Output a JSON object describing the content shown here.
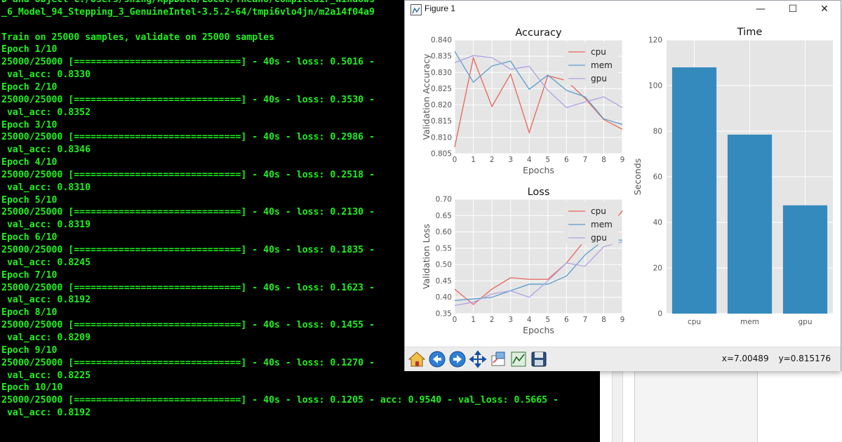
{
  "terminal": {
    "lines": [
      "D and object C:/Users/shing/AppData/Local/Theano/compiledir_Windows",
      "_6_Model_94_Stepping_3_GenuineIntel-3.5.2-64/tmpi6vlo4jn/m2a14f04a9",
      "",
      "Train on 25000 samples, validate on 25000 samples",
      "Epoch 1/10",
      "25000/25000 [==============================] - 40s - loss: 0.5016 -",
      " val_acc: 0.8330",
      "Epoch 2/10",
      "25000/25000 [==============================] - 40s - loss: 0.3530 -",
      " val_acc: 0.8352",
      "Epoch 3/10",
      "25000/25000 [==============================] - 40s - loss: 0.2986 -",
      " val_acc: 0.8346",
      "Epoch 4/10",
      "25000/25000 [==============================] - 40s - loss: 0.2518 -",
      " val_acc: 0.8310",
      "Epoch 5/10",
      "25000/25000 [==============================] - 40s - loss: 0.2130 -",
      " val_acc: 0.8319",
      "Epoch 6/10",
      "25000/25000 [==============================] - 40s - loss: 0.1835 -",
      " val_acc: 0.8245",
      "Epoch 7/10",
      "25000/25000 [==============================] - 40s - loss: 0.1623 -",
      " val_acc: 0.8192",
      "Epoch 8/10",
      "25000/25000 [==============================] - 40s - loss: 0.1455 -",
      " val_acc: 0.8209",
      "Epoch 9/10",
      "25000/25000 [==============================] - 40s - loss: 0.1270 -",
      " val_acc: 0.8225",
      "Epoch 10/10",
      "25000/25000 [==============================] - 40s - loss: 0.1205 - acc: 0.9540 - val_loss: 0.5665 -",
      " val_acc: 0.8192"
    ],
    "text_color": "#1df21d",
    "background": "#000000"
  },
  "figure_window": {
    "title": "Figure 1",
    "minimize_glyph": "—",
    "maximize_glyph": "☐",
    "close_glyph": "✕",
    "toolbar": [
      {
        "name": "home-icon"
      },
      {
        "name": "back-arrow-icon"
      },
      {
        "name": "forward-arrow-icon"
      },
      {
        "name": "pan-icon"
      },
      {
        "name": "zoom-icon"
      },
      {
        "name": "configure-subplots-icon"
      },
      {
        "name": "save-icon"
      }
    ],
    "coords": {
      "x": "x=7.00489",
      "y": "y=0.815176"
    }
  },
  "chart_data": [
    {
      "type": "line",
      "title": "Accuracy",
      "xlabel": "Epochs",
      "ylabel": "Validation Accuracy",
      "xlim": [
        0,
        9
      ],
      "ylim": [
        0.805,
        0.84
      ],
      "xticks": [
        "0",
        "1",
        "2",
        "3",
        "4",
        "5",
        "6",
        "7",
        "8",
        "9"
      ],
      "yticks": [
        "0.805",
        "0.810",
        "0.815",
        "0.820",
        "0.825",
        "0.830",
        "0.835",
        "0.840"
      ],
      "legend": "top-right",
      "grid": true,
      "x": [
        0,
        1,
        2,
        3,
        4,
        5,
        6,
        7,
        8,
        9
      ],
      "series": [
        {
          "name": "cpu",
          "color": "#e8655a",
          "values": [
            0.807,
            0.8345,
            0.8195,
            0.8295,
            0.8115,
            0.829,
            0.8275,
            0.822,
            0.8155,
            0.8125
          ]
        },
        {
          "name": "mem",
          "color": "#5a9ecf",
          "values": [
            0.8365,
            0.827,
            0.832,
            0.8335,
            0.8248,
            0.8292,
            0.8245,
            0.8225,
            0.8157,
            0.814
          ]
        },
        {
          "name": "gpu",
          "color": "#b0a2e0",
          "values": [
            0.833,
            0.8352,
            0.8346,
            0.831,
            0.8319,
            0.8245,
            0.8192,
            0.8209,
            0.8225,
            0.8192
          ]
        }
      ]
    },
    {
      "type": "line",
      "title": "Loss",
      "xlabel": "Epochs",
      "ylabel": "Validation Loss",
      "xlim": [
        0,
        9
      ],
      "ylim": [
        0.35,
        0.7
      ],
      "xticks": [
        "0",
        "1",
        "2",
        "3",
        "4",
        "5",
        "6",
        "7",
        "8",
        "9"
      ],
      "yticks": [
        "0.35",
        "0.40",
        "0.45",
        "0.50",
        "0.55",
        "0.60",
        "0.65",
        "0.70"
      ],
      "legend": "top-right",
      "grid": true,
      "x": [
        0,
        1,
        2,
        3,
        4,
        5,
        6,
        7,
        8,
        9
      ],
      "series": [
        {
          "name": "cpu",
          "color": "#e8655a",
          "values": [
            0.425,
            0.378,
            0.425,
            0.46,
            0.455,
            0.455,
            0.505,
            0.575,
            0.59,
            0.665
          ]
        },
        {
          "name": "mem",
          "color": "#5a9ecf",
          "values": [
            0.39,
            0.395,
            0.4,
            0.42,
            0.44,
            0.44,
            0.465,
            0.53,
            0.575,
            0.575
          ]
        },
        {
          "name": "gpu",
          "color": "#b0a2e0",
          "values": [
            0.375,
            0.385,
            0.41,
            0.42,
            0.4,
            0.45,
            0.505,
            0.495,
            0.555,
            0.57
          ]
        }
      ]
    },
    {
      "type": "bar",
      "title": "Time",
      "ylabel": "Seconds",
      "categories": [
        "cpu",
        "mem",
        "gpu"
      ],
      "values": [
        108,
        78.5,
        47.5
      ],
      "ylim": [
        0,
        120
      ],
      "yticks": [
        "0",
        "20",
        "40",
        "60",
        "80",
        "100",
        "120"
      ],
      "bar_color": "#348abd",
      "grid": true
    }
  ]
}
